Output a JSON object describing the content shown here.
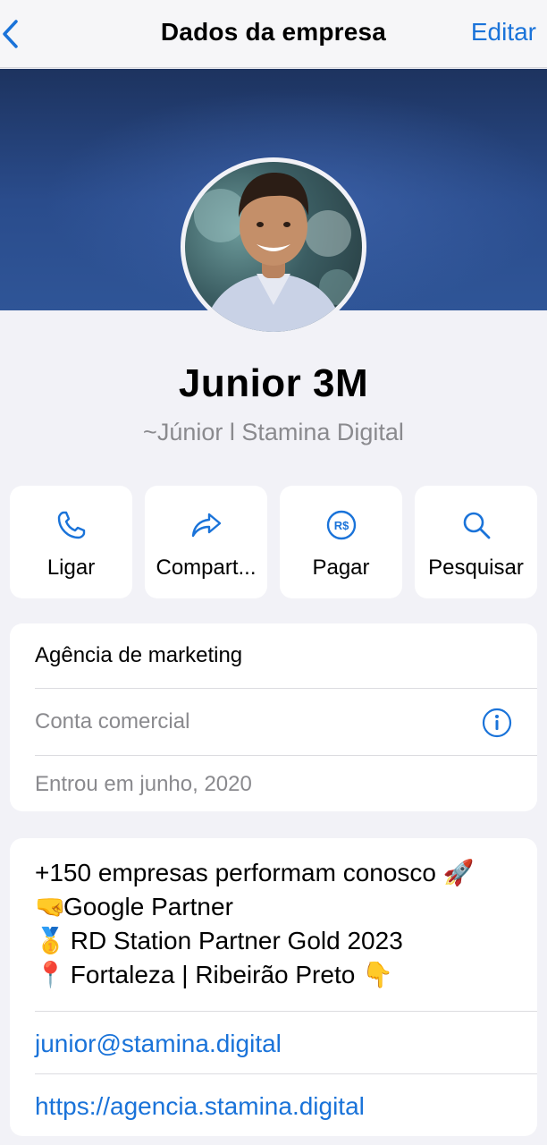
{
  "nav": {
    "title": "Dados da empresa",
    "edit_label": "Editar",
    "back_icon": "chevron-left-icon"
  },
  "profile": {
    "name": "Junior 3M",
    "subtitle": "~Júnior l Stamina Digital"
  },
  "actions": [
    {
      "icon": "phone-icon",
      "label": "Ligar"
    },
    {
      "icon": "share-icon",
      "label": "Compart..."
    },
    {
      "icon": "pay-icon",
      "label": "Pagar",
      "glyph": "R$"
    },
    {
      "icon": "search-icon",
      "label": "Pesquisar"
    }
  ],
  "info": {
    "category": "Agência de marketing",
    "account_type": "Conta comercial",
    "joined": "Entrou em junho, 2020"
  },
  "about": {
    "lines": [
      {
        "text": "+150 empresas performam conosco ",
        "emoji": "🚀"
      },
      {
        "emoji": "🤜",
        "text": "Google Partner"
      },
      {
        "emoji": "🥇",
        "text": " RD Station Partner Gold 2023"
      },
      {
        "emoji": "📍",
        "text": " Fortaleza | Ribeirão Preto ",
        "emoji2": "👇"
      }
    ],
    "email": "junior@stamina.digital",
    "website": "https://agencia.stamina.digital"
  },
  "colors": {
    "accent": "#1a73d9",
    "background": "#f2f2f7",
    "secondary_text": "#8a8a8e"
  }
}
